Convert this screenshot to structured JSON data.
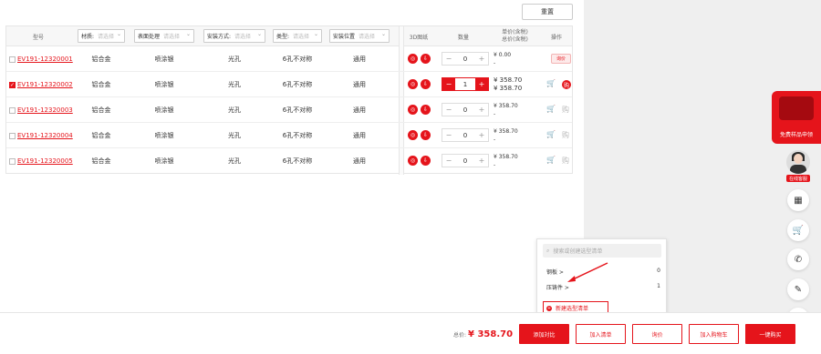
{
  "toolbar": {
    "reset_label": "重置"
  },
  "table": {
    "headers": {
      "model": "型号",
      "material": "材质:",
      "surface": "表面处理",
      "install_method": "安装方式:",
      "type": "类型:",
      "install_position": "安装位置",
      "drawing3d": "3D图纸",
      "qty": "数量",
      "unit_price": "单价(含税)",
      "total_price": "总价(含税)",
      "action": "操作"
    },
    "filter_placeholder": "请选择",
    "rows": [
      {
        "model": "EV191-12320001",
        "material": "铝合金",
        "surface": "喷涂银",
        "install": "光孔",
        "type": "6孔不对称",
        "position": "通用",
        "qty": "0",
        "unit": "¥ 0.00",
        "total": "-",
        "checked": false,
        "action_label": "询价"
      },
      {
        "model": "EV191-12320002",
        "material": "铝合金",
        "surface": "喷涂银",
        "install": "光孔",
        "type": "6孔不对称",
        "position": "通用",
        "qty": "1",
        "unit": "¥ 358.70",
        "total": "¥ 358.70",
        "checked": true,
        "action_label": ""
      },
      {
        "model": "EV191-12320003",
        "material": "铝合金",
        "surface": "喷涂银",
        "install": "光孔",
        "type": "6孔不对称",
        "position": "通用",
        "qty": "0",
        "unit": "¥ 358.70",
        "total": "-",
        "checked": false,
        "action_label": ""
      },
      {
        "model": "EV191-12320004",
        "material": "铝合金",
        "surface": "喷涂银",
        "install": "光孔",
        "type": "6孔不对称",
        "position": "通用",
        "qty": "0",
        "unit": "¥ 358.70",
        "total": "-",
        "checked": false,
        "action_label": ""
      },
      {
        "model": "EV191-12320005",
        "material": "铝合金",
        "surface": "喷涂银",
        "install": "光孔",
        "type": "6孔不对称",
        "position": "通用",
        "qty": "0",
        "unit": "¥ 358.70",
        "total": "-",
        "checked": false,
        "action_label": ""
      }
    ]
  },
  "popup": {
    "search_placeholder": "搜索或创建选型清单",
    "lists": [
      {
        "name": "钢板 >",
        "count": "0"
      },
      {
        "name": "压铸件 >",
        "count": "1"
      }
    ],
    "new_list_label": "新建选型清单"
  },
  "bottom": {
    "total_label": "总价:",
    "total_value": "¥ 358.70",
    "buttons": [
      "添加対比",
      "加入清单",
      "询价",
      "加入购物车",
      "一键购买"
    ]
  },
  "sidebar": {
    "promo_label": "免费样品申领",
    "avatar_label": "在线客服"
  },
  "colors": {
    "accent": "#e5141b"
  }
}
